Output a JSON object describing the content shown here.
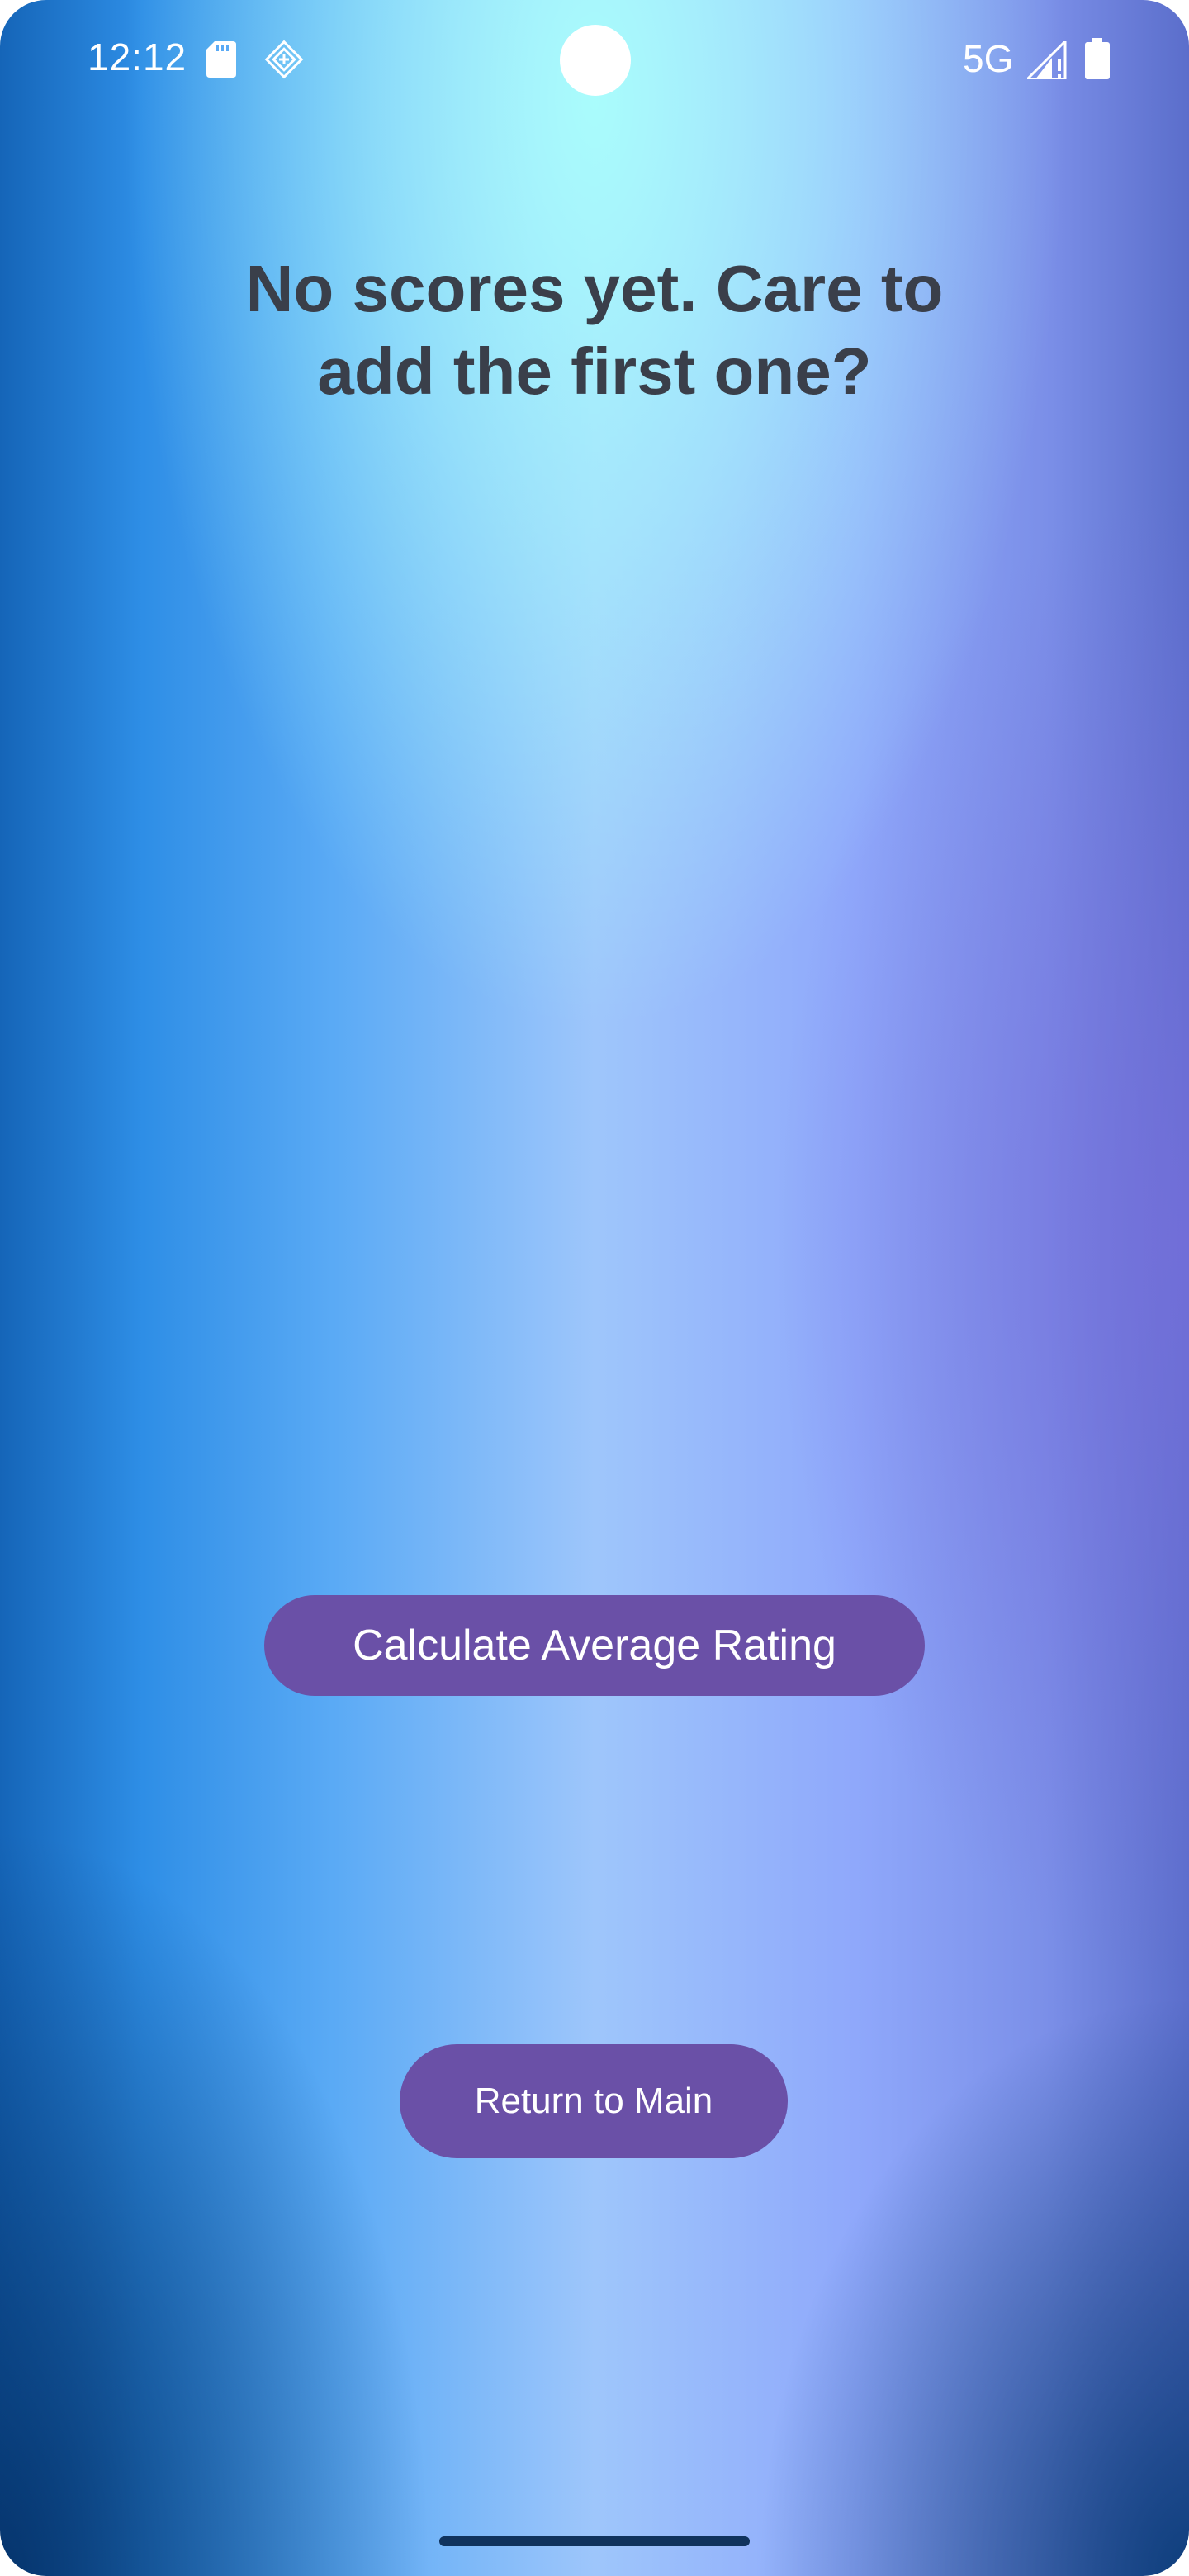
{
  "status_bar": {
    "time": "12:12",
    "network": "5G",
    "icons": [
      "sd-card-icon",
      "app-notification-icon",
      "signal-icon",
      "battery-icon"
    ]
  },
  "main": {
    "empty_message": "No scores yet. Care to add the first one?",
    "calculate_button_label": "Calculate Average Rating",
    "return_button_label": "Return to Main"
  },
  "colors": {
    "button_bg": "#6a50a7",
    "button_text": "#ffffff",
    "message_text": "#3a3f4a",
    "home_indicator": "#10335d"
  }
}
